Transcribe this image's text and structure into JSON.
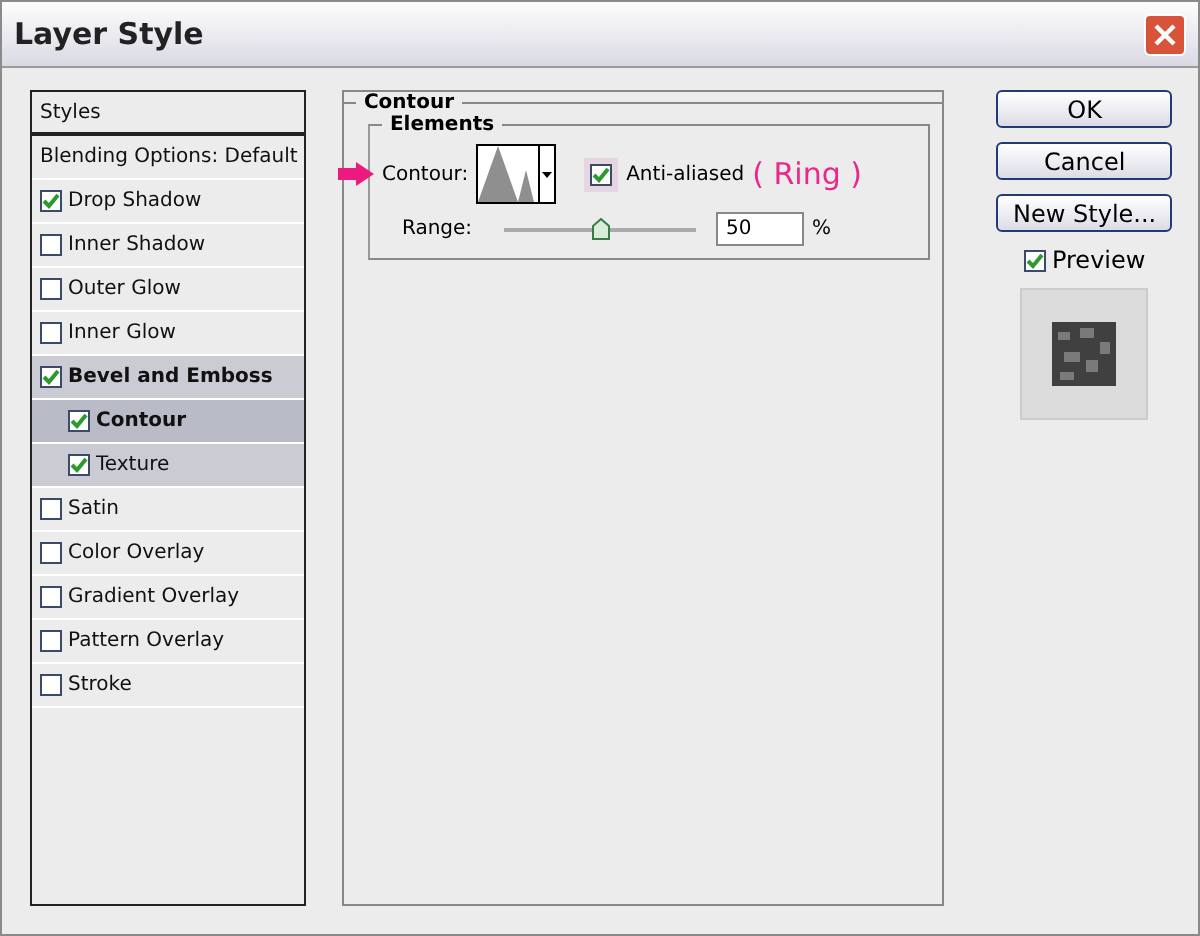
{
  "window": {
    "title": "Layer Style"
  },
  "styles_list": [
    {
      "kind": "header",
      "label": "Styles"
    },
    {
      "kind": "plain",
      "label": "Blending Options: Default"
    },
    {
      "kind": "check",
      "label": "Drop Shadow",
      "checked": true,
      "selected": false
    },
    {
      "kind": "check",
      "label": "Inner Shadow",
      "checked": false,
      "selected": false
    },
    {
      "kind": "check",
      "label": "Outer Glow",
      "checked": false,
      "selected": false
    },
    {
      "kind": "check",
      "label": "Inner Glow",
      "checked": false,
      "selected": false
    },
    {
      "kind": "check",
      "label": "Bevel and Emboss",
      "checked": true,
      "selected": false,
      "expanded": true,
      "children": [
        {
          "label": "Contour",
          "checked": true,
          "selected": true
        },
        {
          "label": "Texture",
          "checked": true,
          "selected": false
        }
      ]
    },
    {
      "kind": "check",
      "label": "Satin",
      "checked": false,
      "selected": false
    },
    {
      "kind": "check",
      "label": "Color Overlay",
      "checked": false,
      "selected": false
    },
    {
      "kind": "check",
      "label": "Gradient Overlay",
      "checked": false,
      "selected": false
    },
    {
      "kind": "check",
      "label": "Pattern Overlay",
      "checked": false,
      "selected": false
    },
    {
      "kind": "check",
      "label": "Stroke",
      "checked": false,
      "selected": false
    }
  ],
  "panel": {
    "title": "Contour",
    "group": "Elements",
    "contour_label": "Contour:",
    "anti_aliased": {
      "label": "Anti-aliased",
      "checked": true
    },
    "annotation": "( Ring )",
    "range": {
      "label": "Range:",
      "level": 0.5,
      "value": "50",
      "unit": "%"
    }
  },
  "buttons": [
    "OK",
    "Cancel",
    "New Style..."
  ],
  "preview": {
    "label": "Preview",
    "checked": true
  }
}
